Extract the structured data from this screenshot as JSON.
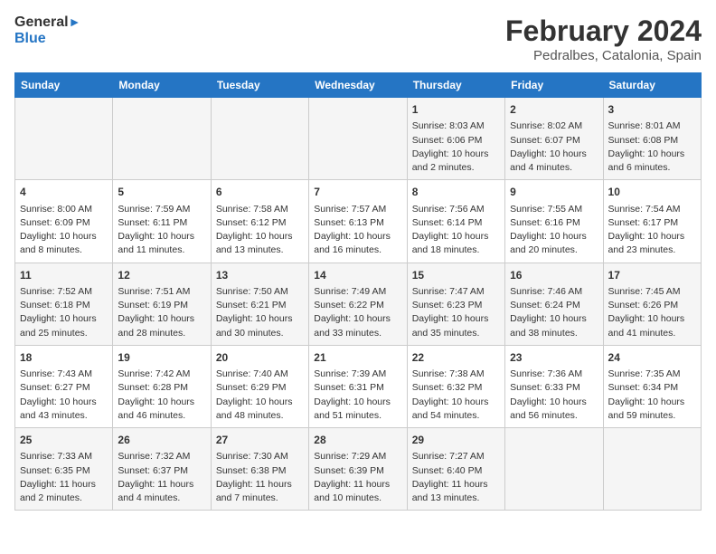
{
  "logo": {
    "line1": "General",
    "line2": "Blue"
  },
  "title": "February 2024",
  "subtitle": "Pedralbes, Catalonia, Spain",
  "weekdays": [
    "Sunday",
    "Monday",
    "Tuesday",
    "Wednesday",
    "Thursday",
    "Friday",
    "Saturday"
  ],
  "weeks": [
    [
      {
        "day": "",
        "info": ""
      },
      {
        "day": "",
        "info": ""
      },
      {
        "day": "",
        "info": ""
      },
      {
        "day": "",
        "info": ""
      },
      {
        "day": "1",
        "info": "Sunrise: 8:03 AM\nSunset: 6:06 PM\nDaylight: 10 hours\nand 2 minutes."
      },
      {
        "day": "2",
        "info": "Sunrise: 8:02 AM\nSunset: 6:07 PM\nDaylight: 10 hours\nand 4 minutes."
      },
      {
        "day": "3",
        "info": "Sunrise: 8:01 AM\nSunset: 6:08 PM\nDaylight: 10 hours\nand 6 minutes."
      }
    ],
    [
      {
        "day": "4",
        "info": "Sunrise: 8:00 AM\nSunset: 6:09 PM\nDaylight: 10 hours\nand 8 minutes."
      },
      {
        "day": "5",
        "info": "Sunrise: 7:59 AM\nSunset: 6:11 PM\nDaylight: 10 hours\nand 11 minutes."
      },
      {
        "day": "6",
        "info": "Sunrise: 7:58 AM\nSunset: 6:12 PM\nDaylight: 10 hours\nand 13 minutes."
      },
      {
        "day": "7",
        "info": "Sunrise: 7:57 AM\nSunset: 6:13 PM\nDaylight: 10 hours\nand 16 minutes."
      },
      {
        "day": "8",
        "info": "Sunrise: 7:56 AM\nSunset: 6:14 PM\nDaylight: 10 hours\nand 18 minutes."
      },
      {
        "day": "9",
        "info": "Sunrise: 7:55 AM\nSunset: 6:16 PM\nDaylight: 10 hours\nand 20 minutes."
      },
      {
        "day": "10",
        "info": "Sunrise: 7:54 AM\nSunset: 6:17 PM\nDaylight: 10 hours\nand 23 minutes."
      }
    ],
    [
      {
        "day": "11",
        "info": "Sunrise: 7:52 AM\nSunset: 6:18 PM\nDaylight: 10 hours\nand 25 minutes."
      },
      {
        "day": "12",
        "info": "Sunrise: 7:51 AM\nSunset: 6:19 PM\nDaylight: 10 hours\nand 28 minutes."
      },
      {
        "day": "13",
        "info": "Sunrise: 7:50 AM\nSunset: 6:21 PM\nDaylight: 10 hours\nand 30 minutes."
      },
      {
        "day": "14",
        "info": "Sunrise: 7:49 AM\nSunset: 6:22 PM\nDaylight: 10 hours\nand 33 minutes."
      },
      {
        "day": "15",
        "info": "Sunrise: 7:47 AM\nSunset: 6:23 PM\nDaylight: 10 hours\nand 35 minutes."
      },
      {
        "day": "16",
        "info": "Sunrise: 7:46 AM\nSunset: 6:24 PM\nDaylight: 10 hours\nand 38 minutes."
      },
      {
        "day": "17",
        "info": "Sunrise: 7:45 AM\nSunset: 6:26 PM\nDaylight: 10 hours\nand 41 minutes."
      }
    ],
    [
      {
        "day": "18",
        "info": "Sunrise: 7:43 AM\nSunset: 6:27 PM\nDaylight: 10 hours\nand 43 minutes."
      },
      {
        "day": "19",
        "info": "Sunrise: 7:42 AM\nSunset: 6:28 PM\nDaylight: 10 hours\nand 46 minutes."
      },
      {
        "day": "20",
        "info": "Sunrise: 7:40 AM\nSunset: 6:29 PM\nDaylight: 10 hours\nand 48 minutes."
      },
      {
        "day": "21",
        "info": "Sunrise: 7:39 AM\nSunset: 6:31 PM\nDaylight: 10 hours\nand 51 minutes."
      },
      {
        "day": "22",
        "info": "Sunrise: 7:38 AM\nSunset: 6:32 PM\nDaylight: 10 hours\nand 54 minutes."
      },
      {
        "day": "23",
        "info": "Sunrise: 7:36 AM\nSunset: 6:33 PM\nDaylight: 10 hours\nand 56 minutes."
      },
      {
        "day": "24",
        "info": "Sunrise: 7:35 AM\nSunset: 6:34 PM\nDaylight: 10 hours\nand 59 minutes."
      }
    ],
    [
      {
        "day": "25",
        "info": "Sunrise: 7:33 AM\nSunset: 6:35 PM\nDaylight: 11 hours\nand 2 minutes."
      },
      {
        "day": "26",
        "info": "Sunrise: 7:32 AM\nSunset: 6:37 PM\nDaylight: 11 hours\nand 4 minutes."
      },
      {
        "day": "27",
        "info": "Sunrise: 7:30 AM\nSunset: 6:38 PM\nDaylight: 11 hours\nand 7 minutes."
      },
      {
        "day": "28",
        "info": "Sunrise: 7:29 AM\nSunset: 6:39 PM\nDaylight: 11 hours\nand 10 minutes."
      },
      {
        "day": "29",
        "info": "Sunrise: 7:27 AM\nSunset: 6:40 PM\nDaylight: 11 hours\nand 13 minutes."
      },
      {
        "day": "",
        "info": ""
      },
      {
        "day": "",
        "info": ""
      }
    ]
  ]
}
